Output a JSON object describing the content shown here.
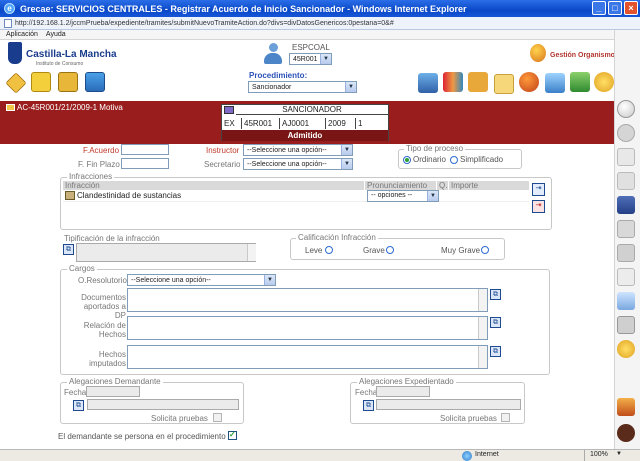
{
  "window": {
    "title": "Grecae: SERVICIOS CENTRALES - Registrar Acuerdo de Inicio Sancionador - Windows Internet Explorer",
    "url": "http://192.168.1.2/jccmPrueba/expediente/tramites/submitNuevoTramiteAction.do?divs=divDatosGenericos:0pestana=0&#"
  },
  "menu": {
    "items": [
      "Aplicación",
      "Ayuda"
    ]
  },
  "header": {
    "brand": "Castilla-La Mancha",
    "brand_sub": "Instituto de Consumo",
    "user_label": "ESPCOAL",
    "user_select": "45R001",
    "gestion_link": "Gestión Organismo"
  },
  "toolbar": {
    "procedimiento_label": "Procedimiento:",
    "procedimiento_value": "Sancionador"
  },
  "case": {
    "reference": "AC-45R001/21/2009-1 Motiva",
    "box_title": "SANCIONADOR",
    "cells": [
      "EX",
      "45R001",
      "AJ0001",
      "2009",
      "1"
    ],
    "status": "Admitido"
  },
  "form": {
    "f_acuerdo_label": "F.Acuerdo",
    "f_fin_plazo_label": "F. Fin Plazo",
    "instructor_label": "Instructor",
    "instructor_value": "--Seleccione una opción--",
    "secretario_label": "Secretario",
    "secretario_value": "--Seleccione una opción--",
    "tipo_proceso": {
      "legend": "Tipo de proceso",
      "options": [
        "Ordinario",
        "Simplificado"
      ],
      "selected": "Ordinario"
    },
    "infracciones": {
      "legend": "Infracciones",
      "columns": [
        "Infracción",
        "Pronunciamiento",
        "Q.",
        "Importe"
      ],
      "rows": [
        {
          "infraccion": "Clandestinidad de sustancias",
          "pronunciamiento": "-- opciones --",
          "q": "",
          "importe": ""
        }
      ]
    },
    "tipificacion_legend": "Tipificación de la infracción",
    "calificacion": {
      "legend": "Calificación Infracción",
      "options": [
        "Leve",
        "Grave",
        "Muy Grave"
      ]
    },
    "cargos": {
      "legend": "Cargos",
      "o_resolutorio_label": "O.Resolutorio",
      "o_resolutorio_value": "--Seleccione una opción--",
      "documentos_label": "Documentos aportados a DP",
      "relacion_label": "Relación de Hechos",
      "hechos_label": "Hechos imputados"
    },
    "alegaciones_demandante": {
      "legend": "Alegaciones Demandante",
      "fecha_label": "Fecha",
      "solicita_label": "Solicita pruebas"
    },
    "alegaciones_expedientado": {
      "legend": "Alegaciones Expedientado",
      "fecha_label": "Fecha",
      "solicita_label": "Solicita pruebas"
    },
    "persona_label": "El demandante se persona en el procedimiento",
    "persona_checked": true
  },
  "statusbar": {
    "zone": "Internet",
    "zoom": "100%"
  }
}
